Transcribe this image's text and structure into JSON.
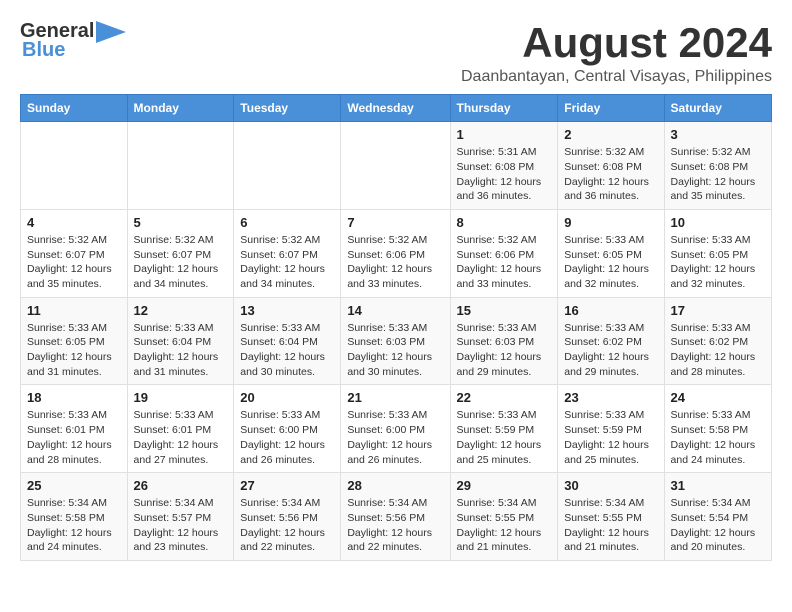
{
  "header": {
    "logo_general": "General",
    "logo_blue": "Blue",
    "title": "August 2024",
    "subtitle": "Daanbantayan, Central Visayas, Philippines"
  },
  "calendar": {
    "days_of_week": [
      "Sunday",
      "Monday",
      "Tuesday",
      "Wednesday",
      "Thursday",
      "Friday",
      "Saturday"
    ],
    "weeks": [
      [
        {
          "day": "",
          "content": ""
        },
        {
          "day": "",
          "content": ""
        },
        {
          "day": "",
          "content": ""
        },
        {
          "day": "",
          "content": ""
        },
        {
          "day": "1",
          "content": "Sunrise: 5:31 AM\nSunset: 6:08 PM\nDaylight: 12 hours and 36 minutes."
        },
        {
          "day": "2",
          "content": "Sunrise: 5:32 AM\nSunset: 6:08 PM\nDaylight: 12 hours and 36 minutes."
        },
        {
          "day": "3",
          "content": "Sunrise: 5:32 AM\nSunset: 6:08 PM\nDaylight: 12 hours and 35 minutes."
        }
      ],
      [
        {
          "day": "4",
          "content": "Sunrise: 5:32 AM\nSunset: 6:07 PM\nDaylight: 12 hours and 35 minutes."
        },
        {
          "day": "5",
          "content": "Sunrise: 5:32 AM\nSunset: 6:07 PM\nDaylight: 12 hours and 34 minutes."
        },
        {
          "day": "6",
          "content": "Sunrise: 5:32 AM\nSunset: 6:07 PM\nDaylight: 12 hours and 34 minutes."
        },
        {
          "day": "7",
          "content": "Sunrise: 5:32 AM\nSunset: 6:06 PM\nDaylight: 12 hours and 33 minutes."
        },
        {
          "day": "8",
          "content": "Sunrise: 5:32 AM\nSunset: 6:06 PM\nDaylight: 12 hours and 33 minutes."
        },
        {
          "day": "9",
          "content": "Sunrise: 5:33 AM\nSunset: 6:05 PM\nDaylight: 12 hours and 32 minutes."
        },
        {
          "day": "10",
          "content": "Sunrise: 5:33 AM\nSunset: 6:05 PM\nDaylight: 12 hours and 32 minutes."
        }
      ],
      [
        {
          "day": "11",
          "content": "Sunrise: 5:33 AM\nSunset: 6:05 PM\nDaylight: 12 hours and 31 minutes."
        },
        {
          "day": "12",
          "content": "Sunrise: 5:33 AM\nSunset: 6:04 PM\nDaylight: 12 hours and 31 minutes."
        },
        {
          "day": "13",
          "content": "Sunrise: 5:33 AM\nSunset: 6:04 PM\nDaylight: 12 hours and 30 minutes."
        },
        {
          "day": "14",
          "content": "Sunrise: 5:33 AM\nSunset: 6:03 PM\nDaylight: 12 hours and 30 minutes."
        },
        {
          "day": "15",
          "content": "Sunrise: 5:33 AM\nSunset: 6:03 PM\nDaylight: 12 hours and 29 minutes."
        },
        {
          "day": "16",
          "content": "Sunrise: 5:33 AM\nSunset: 6:02 PM\nDaylight: 12 hours and 29 minutes."
        },
        {
          "day": "17",
          "content": "Sunrise: 5:33 AM\nSunset: 6:02 PM\nDaylight: 12 hours and 28 minutes."
        }
      ],
      [
        {
          "day": "18",
          "content": "Sunrise: 5:33 AM\nSunset: 6:01 PM\nDaylight: 12 hours and 28 minutes."
        },
        {
          "day": "19",
          "content": "Sunrise: 5:33 AM\nSunset: 6:01 PM\nDaylight: 12 hours and 27 minutes."
        },
        {
          "day": "20",
          "content": "Sunrise: 5:33 AM\nSunset: 6:00 PM\nDaylight: 12 hours and 26 minutes."
        },
        {
          "day": "21",
          "content": "Sunrise: 5:33 AM\nSunset: 6:00 PM\nDaylight: 12 hours and 26 minutes."
        },
        {
          "day": "22",
          "content": "Sunrise: 5:33 AM\nSunset: 5:59 PM\nDaylight: 12 hours and 25 minutes."
        },
        {
          "day": "23",
          "content": "Sunrise: 5:33 AM\nSunset: 5:59 PM\nDaylight: 12 hours and 25 minutes."
        },
        {
          "day": "24",
          "content": "Sunrise: 5:33 AM\nSunset: 5:58 PM\nDaylight: 12 hours and 24 minutes."
        }
      ],
      [
        {
          "day": "25",
          "content": "Sunrise: 5:34 AM\nSunset: 5:58 PM\nDaylight: 12 hours and 24 minutes."
        },
        {
          "day": "26",
          "content": "Sunrise: 5:34 AM\nSunset: 5:57 PM\nDaylight: 12 hours and 23 minutes."
        },
        {
          "day": "27",
          "content": "Sunrise: 5:34 AM\nSunset: 5:56 PM\nDaylight: 12 hours and 22 minutes."
        },
        {
          "day": "28",
          "content": "Sunrise: 5:34 AM\nSunset: 5:56 PM\nDaylight: 12 hours and 22 minutes."
        },
        {
          "day": "29",
          "content": "Sunrise: 5:34 AM\nSunset: 5:55 PM\nDaylight: 12 hours and 21 minutes."
        },
        {
          "day": "30",
          "content": "Sunrise: 5:34 AM\nSunset: 5:55 PM\nDaylight: 12 hours and 21 minutes."
        },
        {
          "day": "31",
          "content": "Sunrise: 5:34 AM\nSunset: 5:54 PM\nDaylight: 12 hours and 20 minutes."
        }
      ]
    ]
  }
}
